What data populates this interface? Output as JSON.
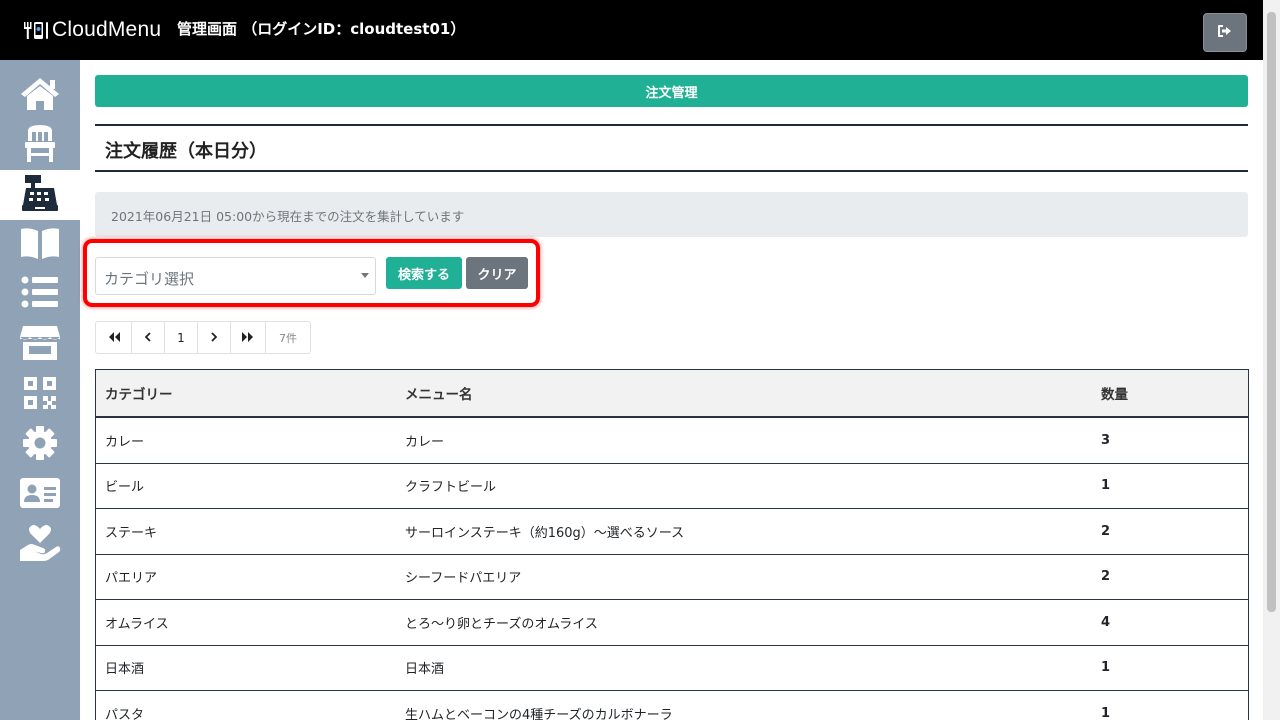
{
  "header": {
    "brand": "CloudMenu",
    "title": "管理画面 （ログインID：cloudtest01）",
    "logout_icon": "sign-out-icon"
  },
  "sidebar": {
    "items": [
      {
        "icon": "home-icon",
        "active": false
      },
      {
        "icon": "chair-icon",
        "active": false
      },
      {
        "icon": "cash-register-icon",
        "active": true
      },
      {
        "icon": "book-open-icon",
        "active": false
      },
      {
        "icon": "list-icon",
        "active": false
      },
      {
        "icon": "store-icon",
        "active": false
      },
      {
        "icon": "qrcode-icon",
        "active": false
      },
      {
        "icon": "gear-icon",
        "active": false
      },
      {
        "icon": "id-card-icon",
        "active": false
      },
      {
        "icon": "hand-holding-heart-icon",
        "active": false
      }
    ]
  },
  "main": {
    "banner": "注文管理",
    "section_title": "注文履歴（本日分）",
    "info": "2021年06月21日 05:00から現在までの注文を集計しています",
    "filter": {
      "category_placeholder": "カテゴリ選択",
      "search_label": "検索する",
      "clear_label": "クリア"
    },
    "pagination": {
      "first": "«",
      "prev": "‹",
      "current": "1",
      "next": "›",
      "last": "»",
      "count": "7件"
    },
    "table": {
      "headers": [
        "カテゴリー",
        "メニュー名",
        "数量"
      ],
      "rows": [
        {
          "category": "カレー",
          "menu": "カレー",
          "qty": "3"
        },
        {
          "category": "ビール",
          "menu": "クラフトビール",
          "qty": "1"
        },
        {
          "category": "ステーキ",
          "menu": "サーロインステーキ（約160g）～選べるソース",
          "qty": "2"
        },
        {
          "category": "パエリア",
          "menu": "シーフードパエリア",
          "qty": "2"
        },
        {
          "category": "オムライス",
          "menu": "とろ～り卵とチーズのオムライス",
          "qty": "4"
        },
        {
          "category": "日本酒",
          "menu": "日本酒",
          "qty": "1"
        },
        {
          "category": "パスタ",
          "menu": "生ハムとベーコンの4種チーズのカルボナーラ",
          "qty": "1"
        }
      ]
    }
  },
  "colors": {
    "accent": "#20b095",
    "sidebar": "#8fa2b6",
    "header": "#000000",
    "highlight": "#ff0000"
  }
}
